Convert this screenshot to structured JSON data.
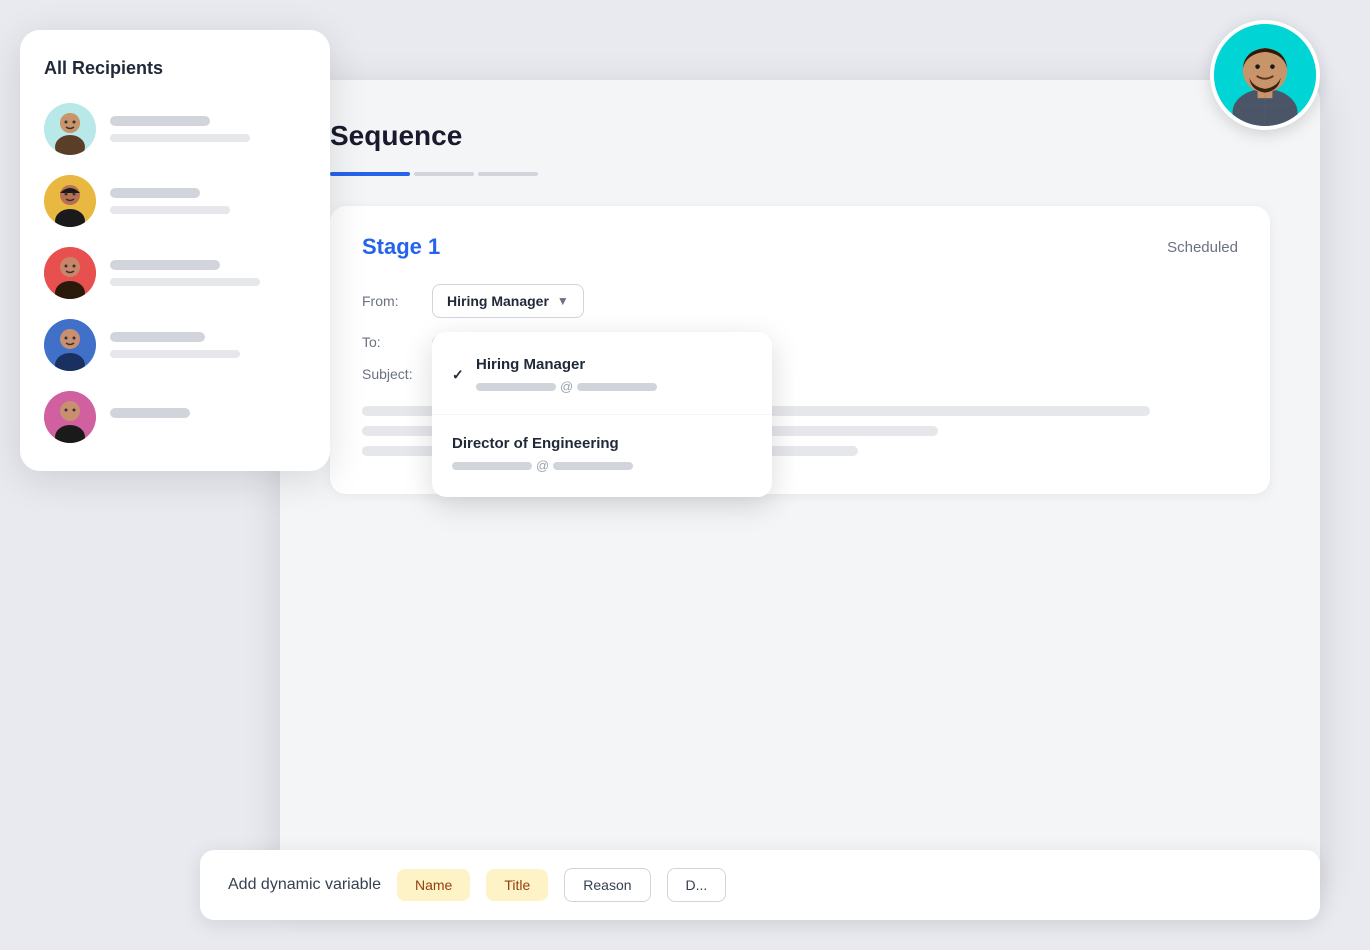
{
  "scene": {
    "title": "Sequence"
  },
  "recipients_panel": {
    "title": "All Recipients",
    "recipients": [
      {
        "id": 1,
        "avatar_color": "cyan",
        "emoji": "👨"
      },
      {
        "id": 2,
        "avatar_color": "yellow",
        "emoji": "👩"
      },
      {
        "id": 3,
        "avatar_color": "red",
        "emoji": "👨"
      },
      {
        "id": 4,
        "avatar_color": "blue",
        "emoji": "👨"
      },
      {
        "id": 5,
        "avatar_color": "pink",
        "emoji": "👩"
      }
    ]
  },
  "stage": {
    "title": "Stage 1",
    "status": "Scheduled",
    "from_label": "From:",
    "to_label": "To:",
    "subject_label": "Subject:",
    "selected_from": "Hiring Manager"
  },
  "dropdown": {
    "items": [
      {
        "name": "Hiring Manager",
        "email_prefix": "",
        "email_suffix": "",
        "selected": true
      },
      {
        "name": "Director of Engineering",
        "email_prefix": "",
        "email_suffix": "",
        "selected": false
      }
    ]
  },
  "dynamic_vars": {
    "label": "Add dynamic variable",
    "tags": [
      {
        "label": "Name",
        "style": "yellow"
      },
      {
        "label": "Title",
        "style": "yellow"
      },
      {
        "label": "Reason",
        "style": "outline"
      },
      {
        "label": "D...",
        "style": "outline"
      }
    ]
  },
  "profile": {
    "emoji": "👨"
  }
}
